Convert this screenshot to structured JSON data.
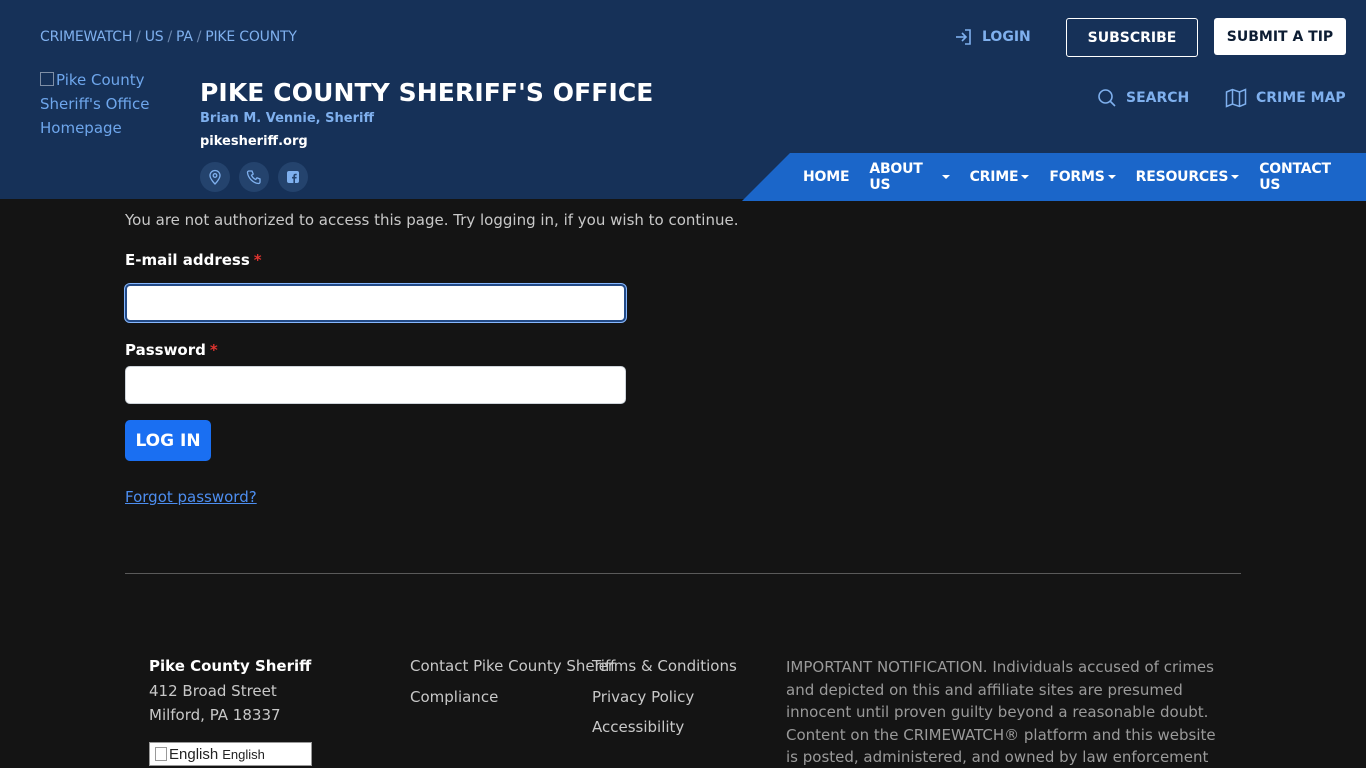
{
  "breadcrumb": [
    "CRIMEWATCH",
    "US",
    "PA",
    "PIKE COUNTY"
  ],
  "top_actions": {
    "login_label": "LOGIN",
    "subscribe_label": "SUBSCRIBE",
    "submit_tip_label": "SUBMIT A TIP"
  },
  "logo": {
    "alt_text": "Pike County Sheriff's Office Homepage"
  },
  "agency": {
    "title": "PIKE COUNTY SHERIFF'S OFFICE",
    "subtitle": "Brian M. Vennie, Sheriff",
    "website": "pikesheriff.org"
  },
  "social_icons": [
    "location-pin-icon",
    "phone-icon",
    "facebook-icon"
  ],
  "utility_links": {
    "search_label": "SEARCH",
    "crime_map_label": "CRIME MAP"
  },
  "nav": {
    "items": [
      {
        "label": "HOME",
        "dropdown": false
      },
      {
        "label": "ABOUT US",
        "dropdown": true
      },
      {
        "label": "CRIME",
        "dropdown": true
      },
      {
        "label": "FORMS",
        "dropdown": true
      },
      {
        "label": "RESOURCES",
        "dropdown": true
      },
      {
        "label": "CONTACT US",
        "dropdown": false
      }
    ]
  },
  "main": {
    "notice": "You are not authorized to access this page. Try logging in, if you wish to continue.",
    "email_label": "E-mail address",
    "email_value": "",
    "password_label": "Password",
    "password_value": "",
    "required_marker": "*",
    "login_button": "LOG IN",
    "forgot_link": "Forgot password?"
  },
  "footer": {
    "name": "Pike County Sheriff",
    "address_line1": "412 Broad Street",
    "address_line2": "Milford, PA 18337",
    "language_alt": "English",
    "language_value": "English",
    "links_col1": [
      "Contact Pike County Sheriff",
      "Compliance"
    ],
    "links_col2": [
      "Terms & Conditions",
      "Privacy Policy",
      "Accessibility"
    ],
    "important_notice": "IMPORTANT NOTIFICATION. Individuals accused of crimes and depicted on this and affiliate sites are presumed innocent until proven guilty beyond a reasonable doubt. Content on the CRIMEWATCH® platform and this website is posted, administered, and owned by law enforcement agencies, and is"
  },
  "colors": {
    "header_bg": "#163158",
    "nav_bg": "#1b66c9",
    "accent_link": "#7fb0ee",
    "page_bg": "#141414",
    "primary_button": "#1a6ff2"
  }
}
